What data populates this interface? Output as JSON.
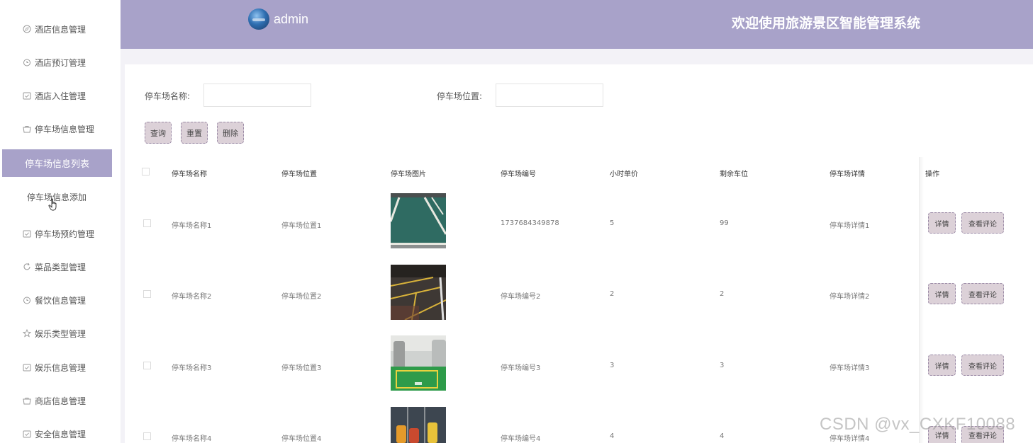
{
  "header": {
    "username": "admin",
    "system_title": "欢迎使用旅游景区智能管理系统"
  },
  "sidebar": {
    "items": [
      {
        "label": "酒店信息管理",
        "icon": "compass-icon"
      },
      {
        "label": "酒店预订管理",
        "icon": "clock-icon"
      },
      {
        "label": "酒店入住管理",
        "icon": "calendar-check-icon"
      },
      {
        "label": "停车场信息管理",
        "icon": "basket-icon"
      },
      {
        "label": "停车场信息列表",
        "icon": ""
      },
      {
        "label": "停车场信息添加",
        "icon": ""
      },
      {
        "label": "停车场预约管理",
        "icon": "calendar-check-icon"
      },
      {
        "label": "菜品类型管理",
        "icon": "refresh-icon"
      },
      {
        "label": "餐饮信息管理",
        "icon": "clock-icon"
      },
      {
        "label": "娱乐类型管理",
        "icon": "star-icon"
      },
      {
        "label": "娱乐信息管理",
        "icon": "calendar-check-icon"
      },
      {
        "label": "商店信息管理",
        "icon": "basket-icon"
      },
      {
        "label": "安全信息管理",
        "icon": "calendar-check-icon"
      }
    ]
  },
  "search": {
    "name_label": "停车场名称:",
    "name_value": "",
    "location_label": "停车场位置:",
    "location_value": ""
  },
  "actions": {
    "query": "查询",
    "reset": "重置",
    "delete": "删除"
  },
  "table": {
    "headers": [
      "停车场名称",
      "停车场位置",
      "停车场图片",
      "停车场编号",
      "小时单价",
      "剩余车位",
      "停车场详情",
      "操作"
    ],
    "detail_button": "详情",
    "review_button": "查看评论",
    "rows": [
      {
        "name": "停车场名称1",
        "location": "停车场位置1",
        "image": "parking-lot-photo-1",
        "code": "1737684349878",
        "price": "5",
        "spaces": "99",
        "details": "停车场详情1"
      },
      {
        "name": "停车场名称2",
        "location": "停车场位置2",
        "image": "parking-lot-photo-2",
        "code": "停车场编号2",
        "price": "2",
        "spaces": "2",
        "details": "停车场详情2"
      },
      {
        "name": "停车场名称3",
        "location": "停车场位置3",
        "image": "parking-lot-photo-3",
        "code": "停车场编号3",
        "price": "3",
        "spaces": "3",
        "details": "停车场详情3"
      },
      {
        "name": "停车场名称4",
        "location": "停车场位置4",
        "image": "parking-lot-photo-4",
        "code": "停车场编号4",
        "price": "4",
        "spaces": "4",
        "details": "停车场详情4"
      }
    ]
  },
  "watermark": "CSDN @vx_CXKF10088",
  "colors": {
    "accent": "#a8a2c9",
    "button_bg": "#dcd1d8",
    "button_border": "#9a8aa6"
  }
}
